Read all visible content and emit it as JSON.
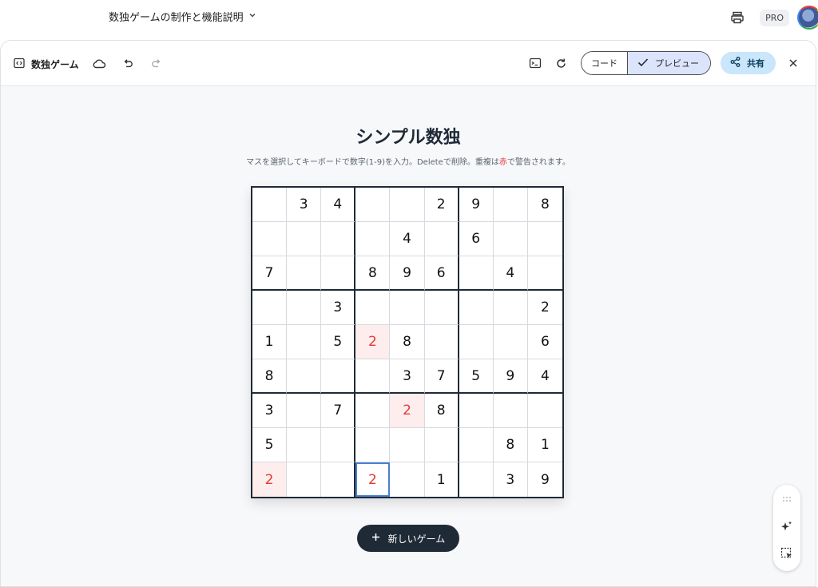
{
  "topbar": {
    "chat_title": "数独ゲームの制作と機能説明",
    "pro_label": "PRO"
  },
  "toolbar": {
    "doc_title": "数独ゲーム",
    "code_label": "コード",
    "preview_label": "プレビュー",
    "share_label": "共有"
  },
  "game": {
    "title": "シンプル数独",
    "instructions_pre": "マスを選択してキーボードで数字(1-9)を入力。Deleteで削除。重複は",
    "instructions_red": "赤",
    "instructions_post": "で警告されます。",
    "new_game_label": "新しいゲーム",
    "grid": [
      [
        "",
        "3",
        "4",
        "",
        "",
        "2",
        "9",
        "",
        "8"
      ],
      [
        "",
        "",
        "",
        "",
        "4",
        "",
        "6",
        "",
        ""
      ],
      [
        "7",
        "",
        "",
        "8",
        "9",
        "6",
        "",
        "4",
        ""
      ],
      [
        "",
        "",
        "3",
        "",
        "",
        "",
        "",
        "",
        "2"
      ],
      [
        "1",
        "",
        "5",
        "2",
        "8",
        "",
        "",
        "",
        "6"
      ],
      [
        "8",
        "",
        "",
        "",
        "3",
        "7",
        "5",
        "9",
        "4"
      ],
      [
        "3",
        "",
        "7",
        "",
        "2",
        "8",
        "",
        "",
        ""
      ],
      [
        "5",
        "",
        "",
        "",
        "",
        "",
        "",
        "8",
        "1"
      ],
      [
        "2",
        "",
        "",
        "2",
        "",
        "1",
        "",
        "3",
        "9"
      ]
    ],
    "conflict_cells": [
      [
        4,
        3
      ],
      [
        6,
        4
      ],
      [
        8,
        0
      ]
    ],
    "selected_cell": [
      8,
      3
    ],
    "error_color": "#e53935"
  },
  "icons": {
    "chat_title_chevron": "chevron-down-icon",
    "print": "print-icon",
    "code_brackets": "code-brackets-icon",
    "cloud": "cloud-icon",
    "undo": "undo-icon",
    "redo": "redo-icon",
    "console": "terminal-icon",
    "refresh": "refresh-icon",
    "check": "check-icon",
    "share": "share-icon",
    "close": "close-icon",
    "plus": "plus-icon",
    "drag": "drag-handle-icon",
    "sparkle": "sparkle-icon",
    "select": "select-element-icon"
  }
}
